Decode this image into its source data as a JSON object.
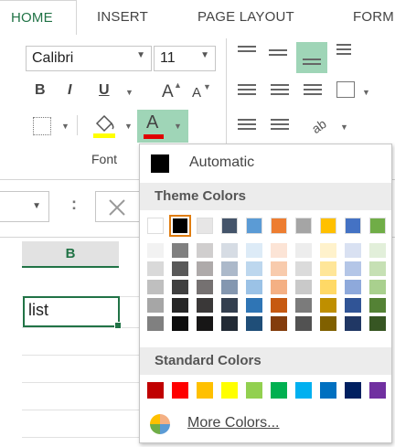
{
  "tabs": [
    "HOME",
    "INSERT",
    "PAGE LAYOUT",
    "FORM"
  ],
  "font": {
    "name": "Calibri",
    "size": "11",
    "group_label": "Font",
    "bold": "B",
    "italic": "I",
    "underline": "U",
    "grow": "A",
    "shrink": "A",
    "font_color_letter": "A"
  },
  "formula_bar": {
    "fx_sep": ":"
  },
  "grid": {
    "column_header": "B",
    "cell_value": "list"
  },
  "dropdown": {
    "automatic_label": "Automatic",
    "theme_header": "Theme Colors",
    "standard_header": "Standard Colors",
    "more_colors_label": "More Colors...",
    "theme_colors": [
      "#FFFFFF",
      "#000000",
      "#E7E6E6",
      "#44546A",
      "#5B9BD5",
      "#ED7D31",
      "#A5A5A5",
      "#FFC000",
      "#4472C4",
      "#70AD47"
    ],
    "theme_shades": [
      [
        "#F2F2F2",
        "#D9D9D9",
        "#BFBFBF",
        "#A6A6A6",
        "#808080"
      ],
      [
        "#808080",
        "#595959",
        "#404040",
        "#262626",
        "#0D0D0D"
      ],
      [
        "#D0CECE",
        "#AEAAAA",
        "#757171",
        "#3A3838",
        "#171616"
      ],
      [
        "#D6DCE4",
        "#ACB9CA",
        "#8497B0",
        "#333F4F",
        "#222A35"
      ],
      [
        "#DDEBF7",
        "#BDD7EE",
        "#9BC2E6",
        "#2F75B5",
        "#1F4E78"
      ],
      [
        "#FCE4D6",
        "#F8CBAD",
        "#F4B084",
        "#C65911",
        "#833C0C"
      ],
      [
        "#EDEDED",
        "#DBDBDB",
        "#C9C9C9",
        "#7B7B7B",
        "#525252"
      ],
      [
        "#FFF2CC",
        "#FFE699",
        "#FFD966",
        "#BF8F00",
        "#806000"
      ],
      [
        "#D9E1F2",
        "#B4C6E7",
        "#8EA9DB",
        "#305496",
        "#203764"
      ],
      [
        "#E2EFDA",
        "#C6E0B4",
        "#A9D08E",
        "#548235",
        "#375623"
      ]
    ],
    "standard_colors": [
      "#C00000",
      "#FF0000",
      "#FFC000",
      "#FFFF00",
      "#92D050",
      "#00B050",
      "#00B0F0",
      "#0070C0",
      "#002060",
      "#7030A0"
    ]
  }
}
